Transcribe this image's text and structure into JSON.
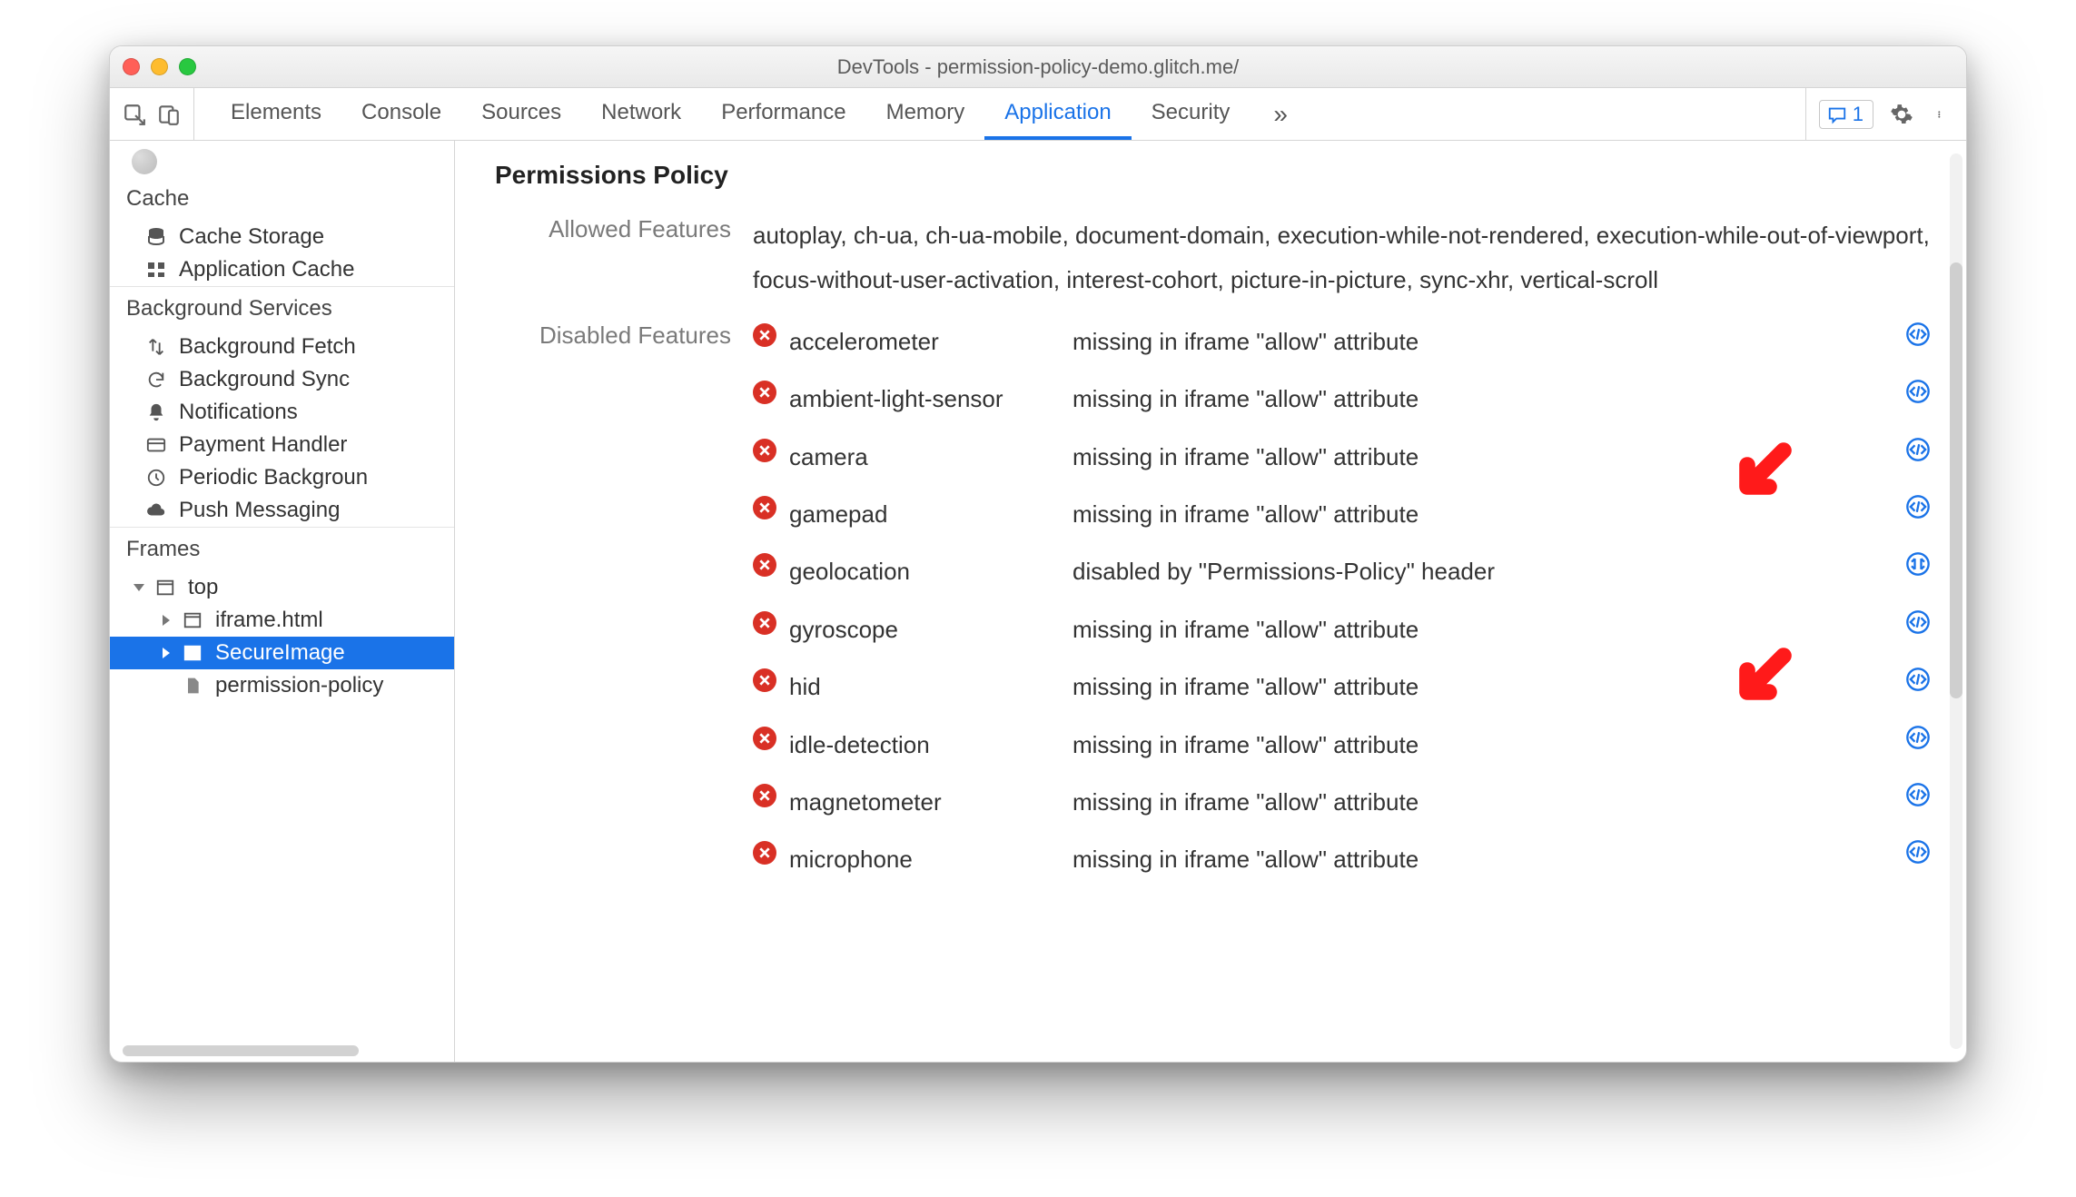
{
  "window": {
    "title": "DevTools - permission-policy-demo.glitch.me/"
  },
  "toolbar": {
    "tabs": [
      "Elements",
      "Console",
      "Sources",
      "Network",
      "Performance",
      "Memory",
      "Application",
      "Security"
    ],
    "active_tab": "Application",
    "issues_count": "1"
  },
  "sidebar": {
    "sections": {
      "cache": {
        "title": "Cache",
        "items": [
          "Cache Storage",
          "Application Cache"
        ]
      },
      "bg": {
        "title": "Background Services",
        "items": [
          "Background Fetch",
          "Background Sync",
          "Notifications",
          "Payment Handler",
          "Periodic Backgroun",
          "Push Messaging"
        ]
      },
      "frames": {
        "title": "Frames",
        "root": "top",
        "children": [
          "iframe.html",
          "SecureImage",
          "permission-policy"
        ],
        "selected": "SecureImage"
      }
    }
  },
  "panel": {
    "title": "Permissions Policy",
    "allowed_label": "Allowed Features",
    "allowed_value": "autoplay, ch-ua, ch-ua-mobile, document-domain, execution-while-not-rendered, execution-while-out-of-viewport, focus-without-user-activation, interest-cohort, picture-in-picture, sync-xhr, vertical-scroll",
    "disabled_label": "Disabled Features",
    "disabled": [
      {
        "name": "accelerometer",
        "reason": "missing in iframe \"allow\" attribute",
        "jump": "code"
      },
      {
        "name": "ambient-light-sensor",
        "reason": "missing in iframe \"allow\" attribute",
        "jump": "code"
      },
      {
        "name": "camera",
        "reason": "missing in iframe \"allow\" attribute",
        "jump": "code"
      },
      {
        "name": "gamepad",
        "reason": "missing in iframe \"allow\" attribute",
        "jump": "code"
      },
      {
        "name": "geolocation",
        "reason": "disabled by \"Permissions-Policy\" header",
        "jump": "network"
      },
      {
        "name": "gyroscope",
        "reason": "missing in iframe \"allow\" attribute",
        "jump": "code"
      },
      {
        "name": "hid",
        "reason": "missing in iframe \"allow\" attribute",
        "jump": "code"
      },
      {
        "name": "idle-detection",
        "reason": "missing in iframe \"allow\" attribute",
        "jump": "code"
      },
      {
        "name": "magnetometer",
        "reason": "missing in iframe \"allow\" attribute",
        "jump": "code"
      },
      {
        "name": "microphone",
        "reason": "missing in iframe \"allow\" attribute",
        "jump": "code"
      }
    ]
  }
}
